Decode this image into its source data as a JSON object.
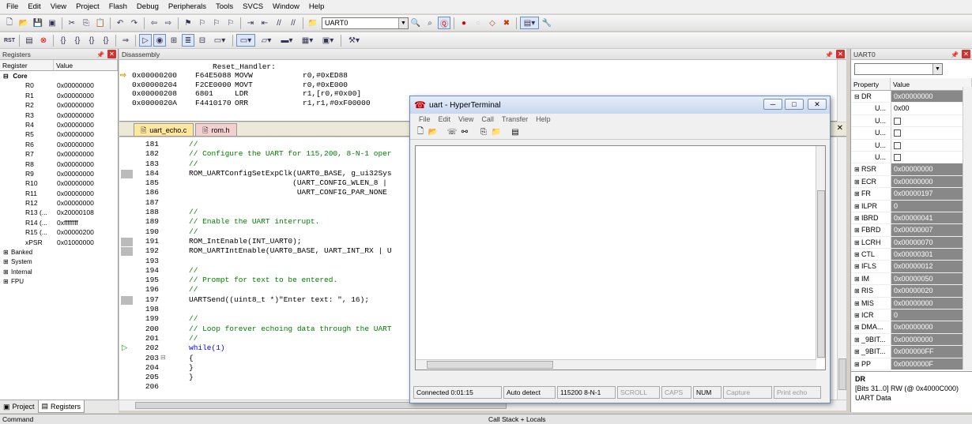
{
  "menu": [
    "File",
    "Edit",
    "View",
    "Project",
    "Flash",
    "Debug",
    "Peripherals",
    "Tools",
    "SVCS",
    "Window",
    "Help"
  ],
  "toolbar": {
    "target_combo": "UART0"
  },
  "registers": {
    "title": "Registers",
    "col_register": "Register",
    "col_value": "Value",
    "core_label": "Core",
    "rows": [
      {
        "n": "R0",
        "v": "0x00000000"
      },
      {
        "n": "R1",
        "v": "0x00000000"
      },
      {
        "n": "R2",
        "v": "0x00000000"
      },
      {
        "n": "R3",
        "v": "0x00000000"
      },
      {
        "n": "R4",
        "v": "0x00000000"
      },
      {
        "n": "R5",
        "v": "0x00000000"
      },
      {
        "n": "R6",
        "v": "0x00000000"
      },
      {
        "n": "R7",
        "v": "0x00000000"
      },
      {
        "n": "R8",
        "v": "0x00000000"
      },
      {
        "n": "R9",
        "v": "0x00000000"
      },
      {
        "n": "R10",
        "v": "0x00000000"
      },
      {
        "n": "R11",
        "v": "0x00000000"
      },
      {
        "n": "R12",
        "v": "0x00000000"
      },
      {
        "n": "R13 (...",
        "v": "0x20000108"
      },
      {
        "n": "R14 (...",
        "v": "0xffffffff"
      },
      {
        "n": "R15 (...",
        "v": "0x00000200"
      },
      {
        "n": "xPSR",
        "v": "0x01000000"
      }
    ],
    "groups": [
      "Banked",
      "System",
      "Internal",
      "FPU"
    ],
    "tab_project": "Project",
    "tab_registers": "Registers"
  },
  "disassembly": {
    "title": "Disassembly",
    "label": "Reset_Handler:",
    "lines": [
      {
        "addr": "0x00000200",
        "op": "F64E5088",
        "mn": "MOVW",
        "args": "r0,#0xED88"
      },
      {
        "addr": "0x00000204",
        "op": "F2CE0000",
        "mn": "MOVT",
        "args": "r0,#0xE000"
      },
      {
        "addr": "0x00000208",
        "op": "6801",
        "mn": "LDR",
        "args": "r1,[r0,#0x00]"
      },
      {
        "addr": "0x0000020A",
        "op": "F4410170",
        "mn": "ORR",
        "args": "r1,r1,#0xF00000"
      }
    ]
  },
  "editor": {
    "tab1": "uart_echo.c",
    "tab2": "rom.h",
    "lines": [
      {
        "n": "181",
        "t": "//",
        "c": "cm"
      },
      {
        "n": "182",
        "t": "// Configure the UART for 115,200, 8-N-1 oper",
        "c": "cm"
      },
      {
        "n": "183",
        "t": "//",
        "c": "cm"
      },
      {
        "n": "184",
        "t": "ROM_UARTConfigSetExpClk(UART0_BASE, g_ui32Sys",
        "c": ""
      },
      {
        "n": "185",
        "t": "                       (UART_CONFIG_WLEN_8 |",
        "c": ""
      },
      {
        "n": "186",
        "t": "                        UART_CONFIG_PAR_NONE",
        "c": ""
      },
      {
        "n": "187",
        "t": "",
        "c": ""
      },
      {
        "n": "188",
        "t": "//",
        "c": "cm"
      },
      {
        "n": "189",
        "t": "// Enable the UART interrupt.",
        "c": "cm"
      },
      {
        "n": "190",
        "t": "//",
        "c": "cm"
      },
      {
        "n": "191",
        "t": "ROM_IntEnable(INT_UART0);",
        "c": ""
      },
      {
        "n": "192",
        "t": "ROM_UARTIntEnable(UART0_BASE, UART_INT_RX | U",
        "c": ""
      },
      {
        "n": "193",
        "t": "",
        "c": ""
      },
      {
        "n": "194",
        "t": "//",
        "c": "cm"
      },
      {
        "n": "195",
        "t": "// Prompt for text to be entered.",
        "c": "cm"
      },
      {
        "n": "196",
        "t": "//",
        "c": "cm"
      },
      {
        "n": "197",
        "t": "UARTSend((uint8_t *)\"Enter text: \", 16);",
        "c": ""
      },
      {
        "n": "198",
        "t": "",
        "c": ""
      },
      {
        "n": "199",
        "t": "//",
        "c": "cm"
      },
      {
        "n": "200",
        "t": "// Loop forever echoing data through the UART",
        "c": "cm"
      },
      {
        "n": "201",
        "t": "//",
        "c": "cm"
      },
      {
        "n": "202",
        "t": "while(1)",
        "c": "kw"
      },
      {
        "n": "203",
        "t": "{",
        "c": ""
      },
      {
        "n": "204",
        "t": "}",
        "c": ""
      },
      {
        "n": "205",
        "t": "}",
        "c": ""
      },
      {
        "n": "206",
        "t": "",
        "c": ""
      }
    ]
  },
  "uart": {
    "title": "UART0",
    "col_property": "Property",
    "col_value": "Value",
    "dr": {
      "n": "DR",
      "v": "0x00000000"
    },
    "dr_sub": [
      {
        "n": "U...",
        "v": "0x00"
      },
      {
        "n": "U...",
        "v": ""
      },
      {
        "n": "U...",
        "v": ""
      },
      {
        "n": "U...",
        "v": ""
      },
      {
        "n": "U...",
        "v": ""
      }
    ],
    "rows": [
      {
        "n": "RSR",
        "v": "0x00000000"
      },
      {
        "n": "ECR",
        "v": "0x00000000"
      },
      {
        "n": "FR",
        "v": "0x00000197"
      },
      {
        "n": "ILPR",
        "v": "0"
      },
      {
        "n": "IBRD",
        "v": "0x00000041"
      },
      {
        "n": "FBRD",
        "v": "0x00000007"
      },
      {
        "n": "LCRH",
        "v": "0x00000070"
      },
      {
        "n": "CTL",
        "v": "0x00000301"
      },
      {
        "n": "IFLS",
        "v": "0x00000012"
      },
      {
        "n": "IM",
        "v": "0x00000050"
      },
      {
        "n": "RIS",
        "v": "0x00000020"
      },
      {
        "n": "MIS",
        "v": "0x00000000"
      },
      {
        "n": "ICR",
        "v": "0"
      },
      {
        "n": "DMA...",
        "v": "0x00000000"
      },
      {
        "n": "_9BIT...",
        "v": "0x00000000"
      },
      {
        "n": "_9BIT...",
        "v": "0x000000FF"
      },
      {
        "n": "PP",
        "v": "0x0000000F"
      }
    ],
    "desc_name": "DR",
    "desc_bits": "[Bits 31..0] RW (@ 0x4000C000)",
    "desc_text": "UART Data"
  },
  "hyperterminal": {
    "title": "uart - HyperTerminal",
    "menu": [
      "File",
      "Edit",
      "View",
      "Call",
      "Transfer",
      "Help"
    ],
    "status": [
      "Connected 0:01:15",
      "Auto detect",
      "115200 8-N-1",
      "SCROLL",
      "CAPS",
      "NUM",
      "Capture",
      "Print echo"
    ]
  },
  "bottom": {
    "command": "Command",
    "callstack": "Call Stack + Locals"
  }
}
